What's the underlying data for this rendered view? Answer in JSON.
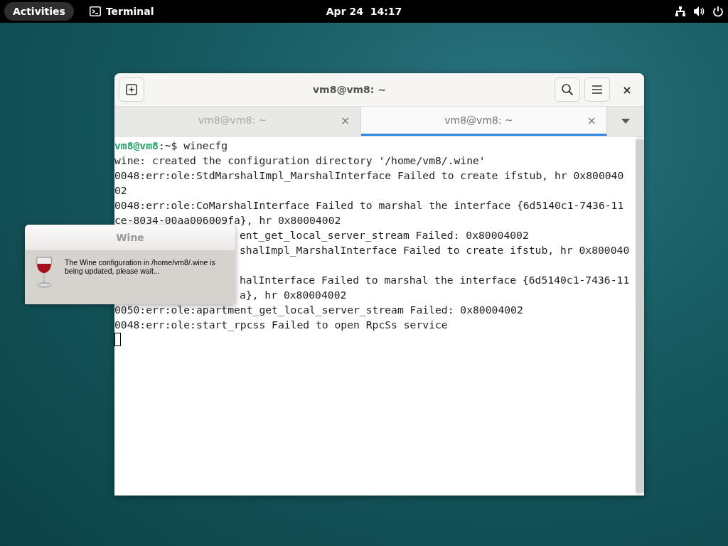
{
  "top_bar": {
    "activities": "Activities",
    "app_name": "Terminal",
    "clock": "Apr 24  14:17"
  },
  "terminal_window": {
    "title": "vm8@vm8: ~",
    "tabs": [
      {
        "label": "vm8@vm8: ~",
        "close": "×",
        "selected": false
      },
      {
        "label": "vm8@vm8: ~",
        "close": "×",
        "selected": true
      }
    ],
    "prompt": {
      "user_host": "vm8@vm8",
      "rest": ":~$ winecfg"
    },
    "lines": [
      {
        "text": "wine: created the configuration directory '/home/vm8/.wine'",
        "covered": false,
        "gap_before": false
      },
      {
        "text": "0048:err:ole:StdMarshalImpl_MarshalInterface Failed to create ifstub, hr 0x800040",
        "covered": false,
        "gap_before": false
      },
      {
        "text": "02",
        "covered": false,
        "gap_before": false
      },
      {
        "text": "0048:err:ole:CoMarshalInterface Failed to marshal the interface {6d5140c1-7436-11",
        "covered": false,
        "gap_before": false
      },
      {
        "text": "ce-8034-00aa006009fa}, hr 0x80004002",
        "covered": false,
        "gap_before": false
      },
      {
        "text": "ent_get_local_server_stream Failed: 0x80004002",
        "covered": true,
        "gap_before": false
      },
      {
        "text": "shalImpl_MarshalInterface Failed to create ifstub, hr 0x800040",
        "covered": true,
        "gap_before": false
      },
      {
        "text": "halInterface Failed to marshal the interface {6d5140c1-7436-11",
        "covered": true,
        "gap_before": true
      },
      {
        "text": "a}, hr 0x80004002",
        "covered": true,
        "gap_before": false
      },
      {
        "text": "0050:err:ole:apartment_get_local_server_stream Failed: 0x80004002",
        "covered": false,
        "gap_before": false
      },
      {
        "text": "0048:err:ole:start_rpcss Failed to open RpcSs service",
        "covered": false,
        "gap_before": false
      }
    ]
  },
  "dialog": {
    "title": "Wine",
    "message": "The Wine configuration in /home/vm8/.wine is being updated, please wait..."
  }
}
